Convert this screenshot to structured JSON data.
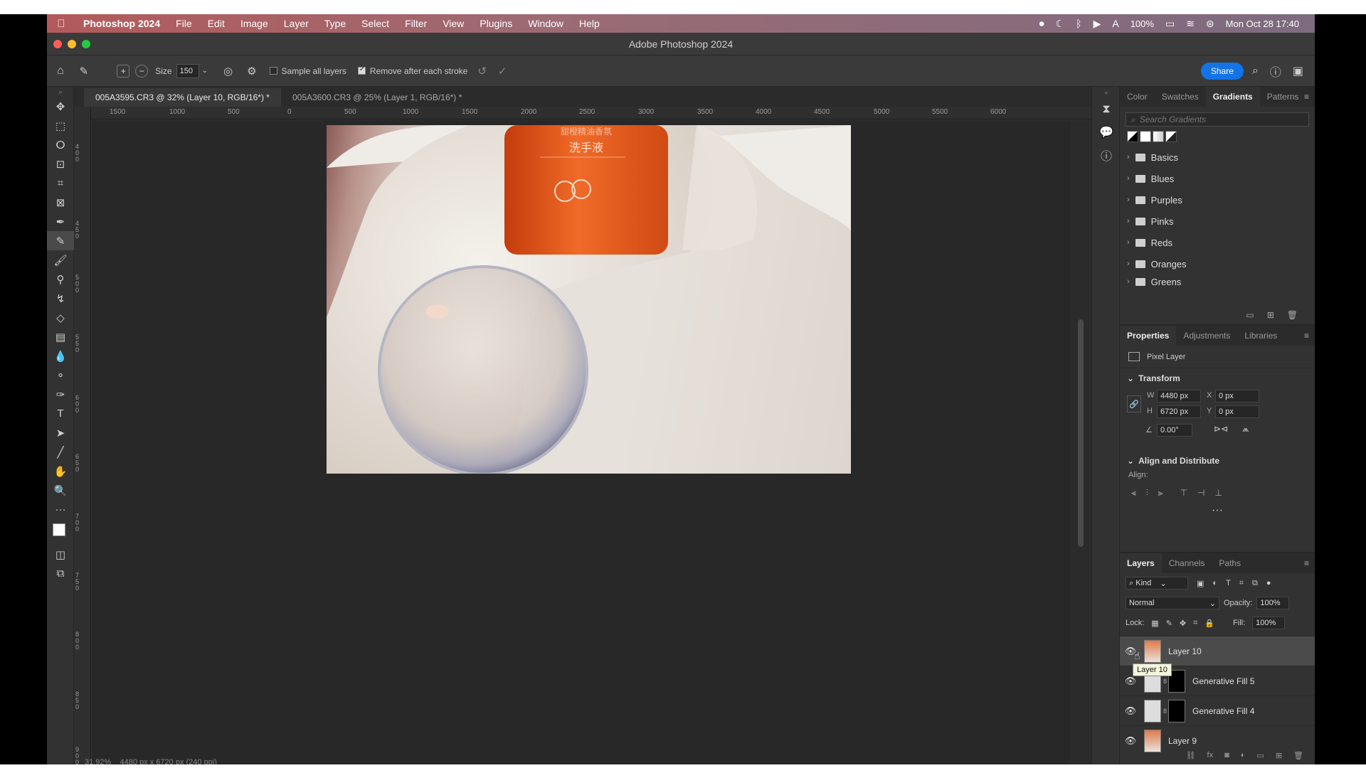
{
  "menubar": {
    "app": "Photoshop 2024",
    "items": [
      "File",
      "Edit",
      "Image",
      "Layer",
      "Type",
      "Select",
      "Filter",
      "View",
      "Plugins",
      "Window",
      "Help"
    ],
    "battery": "100%",
    "datetime": "Mon Oct 28  17:40"
  },
  "window": {
    "title": "Adobe Photoshop 2024"
  },
  "options": {
    "size_label": "Size",
    "size_value": "150",
    "sample_all": "Sample all layers",
    "remove_after": "Remove after each stroke",
    "share": "Share"
  },
  "tabs": [
    {
      "label": "005A3595.CR3 @ 32% (Layer 10, RGB/16*) *"
    },
    {
      "label": "005A3600.CR3 @ 25% (Layer 1, RGB/16*) *"
    }
  ],
  "ruler": {
    "h": [
      "1500",
      "1000",
      "500",
      "0",
      "500",
      "1000",
      "1500",
      "2000",
      "2500",
      "3000",
      "3500",
      "4000",
      "4500",
      "5000",
      "5500",
      "6000"
    ],
    "v": [
      "0",
      "4",
      "5",
      "0",
      "0",
      "5",
      "0",
      "0",
      "6",
      "0",
      "0",
      "6",
      "5",
      "0",
      "7",
      "0",
      "0",
      "7",
      "5",
      "0",
      "8",
      "0",
      "0",
      "8",
      "5",
      "0",
      "9",
      "0",
      "0"
    ]
  },
  "photo": {
    "bottle_text_top": "甜橙精油香氛",
    "bottle_text": "洗手液"
  },
  "gradients_panel": {
    "tabs": [
      "Color",
      "Swatches",
      "Gradients",
      "Patterns"
    ],
    "active": "Gradients",
    "search_placeholder": "Search Gradients",
    "folders": [
      "Basics",
      "Blues",
      "Purples",
      "Pinks",
      "Reds",
      "Oranges",
      "Greens"
    ]
  },
  "properties_panel": {
    "tabs": [
      "Properties",
      "Adjustments",
      "Libraries"
    ],
    "type": "Pixel Layer",
    "transform_title": "Transform",
    "w_label": "W",
    "w": "4480 px",
    "h_label": "H",
    "h": "6720 px",
    "x_label": "X",
    "x": "0 px",
    "y_label": "Y",
    "y": "0 px",
    "angle": "0.00°",
    "align_title": "Align and Distribute",
    "align_label": "Align:"
  },
  "layers_panel": {
    "tabs": [
      "Layers",
      "Channels",
      "Paths"
    ],
    "kind": "Kind",
    "blend": "Normal",
    "opacity_label": "Opacity:",
    "opacity": "100%",
    "lock_label": "Lock:",
    "fill_label": "Fill:",
    "fill": "100%",
    "layers": [
      {
        "name": "Layer 10"
      },
      {
        "name": "Generative Fill 5"
      },
      {
        "name": "Generative Fill 4"
      },
      {
        "name": "Layer 9"
      }
    ],
    "tooltip": "Layer 10"
  },
  "status": {
    "zoom": "31.92%",
    "dims": "4480 px x 6720 px (240 ppi)"
  },
  "colors": {
    "accent": "#1473e6",
    "orange": "#e2541a"
  }
}
